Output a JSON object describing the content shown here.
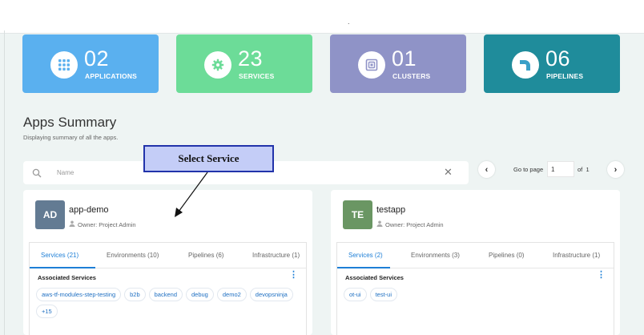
{
  "topbar": {
    "dot": "."
  },
  "stats": [
    {
      "value": "02",
      "label": "APPLICATIONS",
      "icon": "grid-icon"
    },
    {
      "value": "23",
      "label": "SERVICES",
      "icon": "gear-icon"
    },
    {
      "value": "01",
      "label": "CLUSTERS",
      "icon": "cluster-icon"
    },
    {
      "value": "06",
      "label": "PIPELINES",
      "icon": "pipeline-icon"
    }
  ],
  "summary": {
    "title": "Apps Summary",
    "subtitle": "Displaying summary of all the apps."
  },
  "search": {
    "placeholder": "Name",
    "clear": "✕"
  },
  "pagination": {
    "prev": "‹",
    "next": "›",
    "goto_label": "Go to page",
    "page": "1",
    "of_label": "of",
    "total": "1"
  },
  "callout": {
    "text": "Select Service"
  },
  "apps": [
    {
      "initials": "AD",
      "name": "app-demo",
      "owner": "Owner: Project Admin",
      "avatar_color": "#637b93",
      "tabs": [
        "Services (21)",
        "Environments (10)",
        "Pipelines (6)",
        "Infrastructure (1)"
      ],
      "section": "Associated Services",
      "services": [
        "aws-tf-modules-step-testing",
        "b2b",
        "backend",
        "debug",
        "demo2",
        "devopsninja",
        "+15"
      ]
    },
    {
      "initials": "TE",
      "name": "testapp",
      "owner": "Owner: Project Admin",
      "avatar_color": "#6a9663",
      "tabs": [
        "Services (2)",
        "Environments (3)",
        "Pipelines (0)",
        "Infrastructure (1)"
      ],
      "section": "Associated Services",
      "services": [
        "ot-ui",
        "test-ui"
      ]
    }
  ],
  "colors": {
    "applications": "#5ab0ef",
    "services": "#6cdc98",
    "clusters": "#8f93c7",
    "pipelines": "#1f8c9b",
    "accent": "#1e7fd6"
  }
}
